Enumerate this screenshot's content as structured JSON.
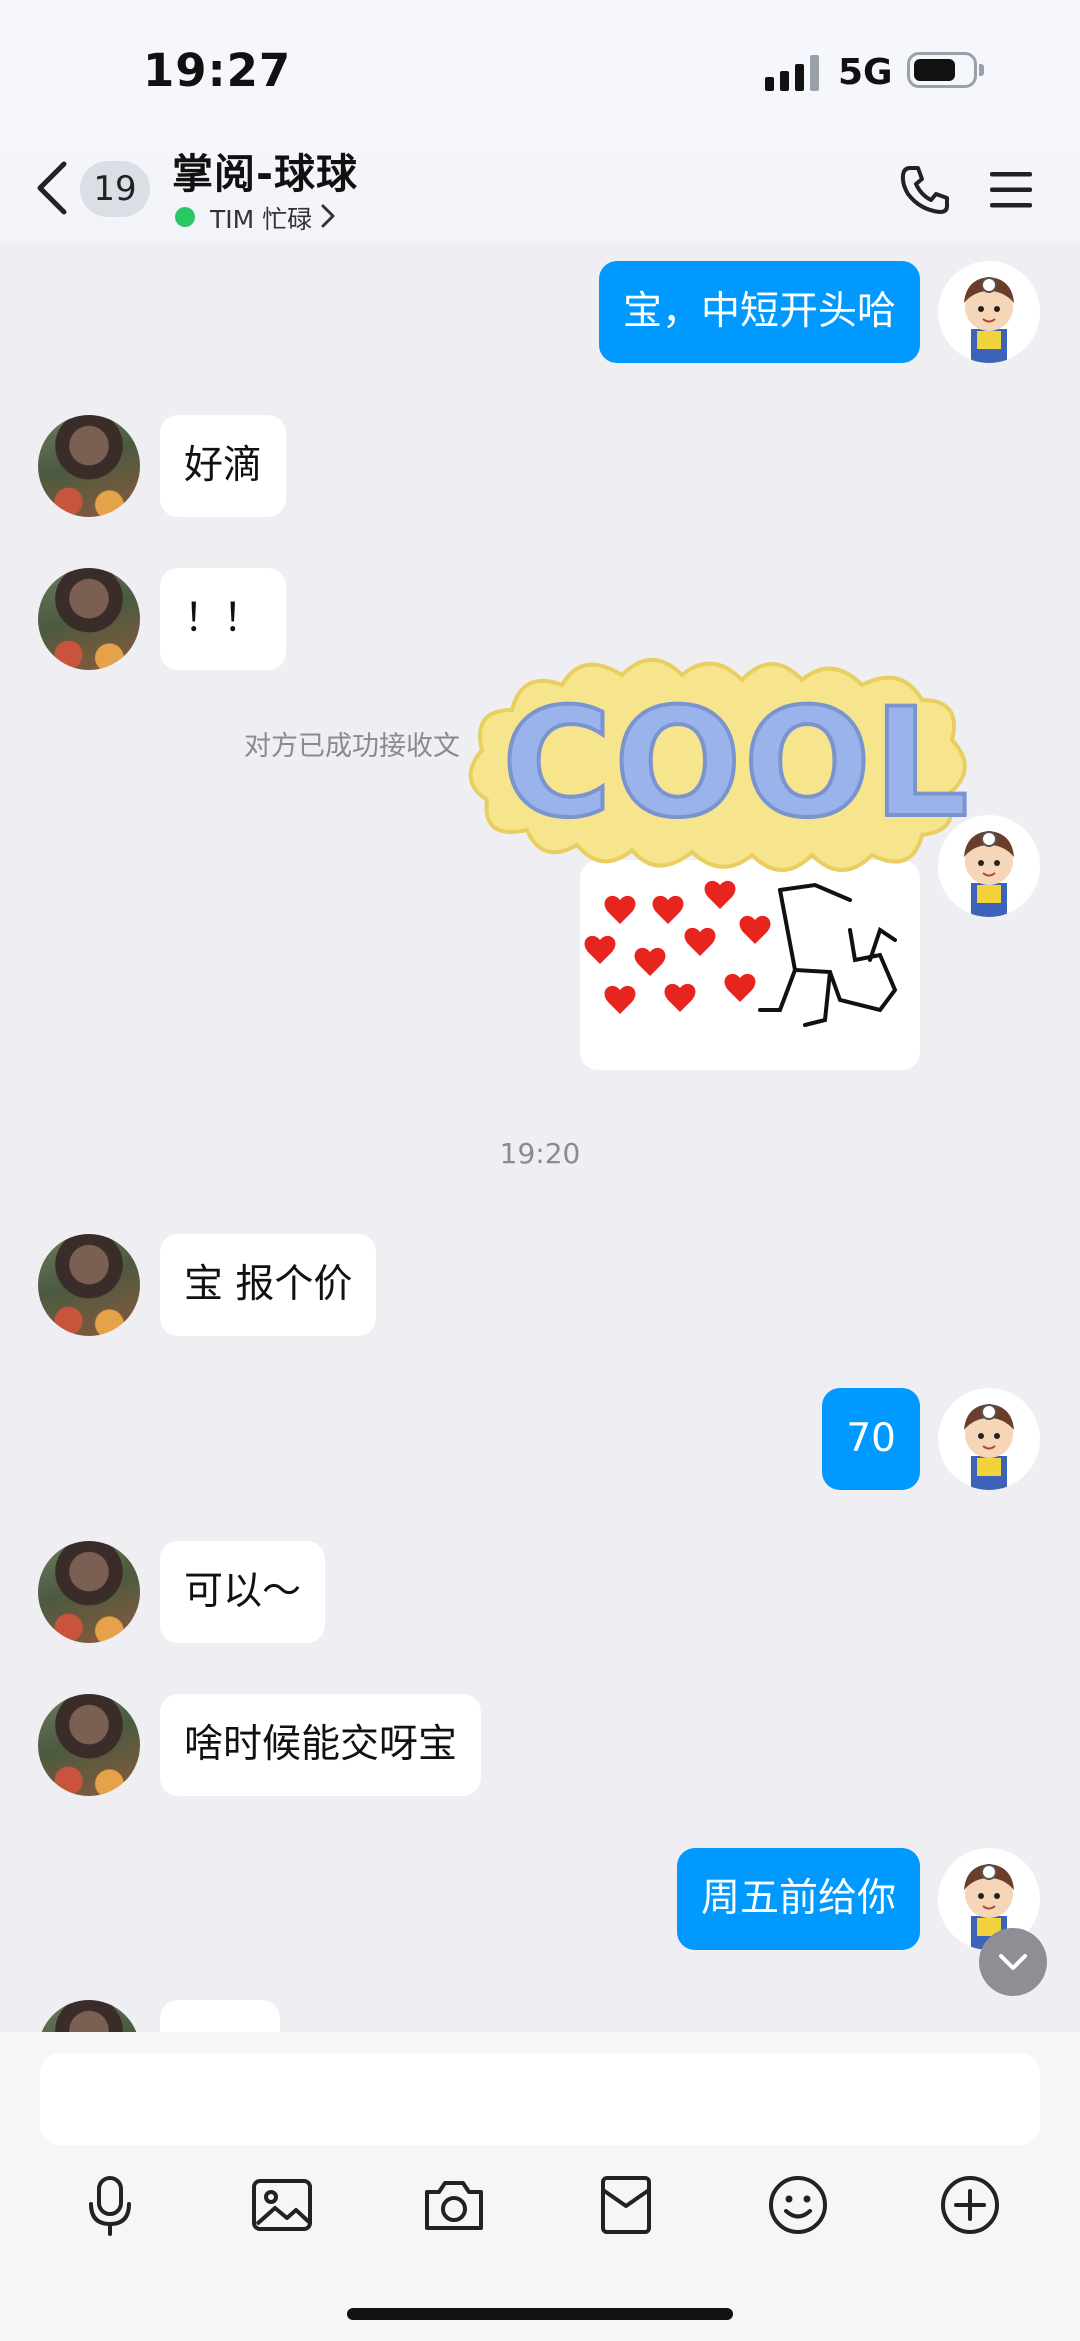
{
  "status_bar": {
    "time": "19:27",
    "network": "5G",
    "battery_level": 0.75
  },
  "header": {
    "unread_count": "19",
    "title": "掌阅-球球",
    "status": "TIM 忙碌",
    "status_color": "#2bc765"
  },
  "colors": {
    "outgoing_bubble": "#0099ff",
    "incoming_bubble": "#ffffff",
    "background": "#eeeef3"
  },
  "messages": [
    {
      "direction": "out",
      "text": "宝，中短开头哈"
    },
    {
      "direction": "in",
      "text": "好滴"
    },
    {
      "direction": "in",
      "text": "！！"
    },
    {
      "direction": "system",
      "text": "对方已成功接收文"
    },
    {
      "direction": "out",
      "type": "sticker",
      "description_icon": "hearts-sticker"
    },
    {
      "direction": "timestamp",
      "text": "19:20"
    },
    {
      "direction": "in",
      "text": "宝  报个价"
    },
    {
      "direction": "out",
      "text": "70"
    },
    {
      "direction": "in",
      "text": "可以～"
    },
    {
      "direction": "in",
      "text": "啥时候能交呀宝"
    },
    {
      "direction": "out",
      "text": "周五前给你"
    }
  ],
  "overlay_sticker": {
    "text": "COOL"
  },
  "composer": {
    "input_value": "",
    "tools": [
      "microphone-icon",
      "image-icon",
      "camera-icon",
      "red-packet-icon",
      "emoji-icon",
      "plus-icon"
    ]
  }
}
